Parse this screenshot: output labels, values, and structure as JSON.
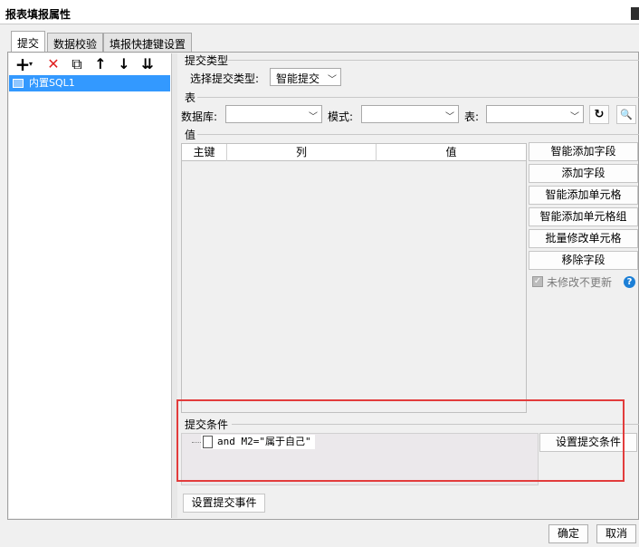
{
  "window": {
    "title": "报表填报属性"
  },
  "tabs": [
    {
      "label": "提交",
      "active": true
    },
    {
      "label": "数据校验",
      "active": false
    },
    {
      "label": "填报快捷键设置",
      "active": false
    }
  ],
  "left_toolbar": {
    "icons": [
      "add-icon",
      "delete-icon",
      "copy-icon",
      "move-up-icon",
      "move-down-icon",
      "move-bottom-icon"
    ],
    "glyphs": {
      "add": "+",
      "add_caret": "▾",
      "delete": "✕",
      "copy": "⧉",
      "up": "↑",
      "down": "↓",
      "bottom": "⇊"
    }
  },
  "tree": {
    "items": [
      {
        "label": "内置SQL1",
        "selected": true
      }
    ]
  },
  "submit_type": {
    "section_label": "提交类型",
    "field_label": "选择提交类型:",
    "value": "智能提交"
  },
  "table_section": {
    "section_label": "表",
    "database_label": "数据库:",
    "database_value": "",
    "schema_label": "模式:",
    "schema_value": "",
    "table_label": "表:",
    "table_value": "",
    "refresh_glyph": "↻",
    "search_glyph": "🔍"
  },
  "value_section": {
    "section_label": "值",
    "columns": [
      "主键",
      "列",
      "值"
    ],
    "rows": []
  },
  "side_buttons": [
    "智能添加字段",
    "添加字段",
    "智能添加单元格",
    "智能添加单元格组",
    "批量修改单元格",
    "移除字段"
  ],
  "no_update_checkbox": {
    "label": "未修改不更新",
    "checked": true,
    "glyph": "✓",
    "help_glyph": "?"
  },
  "submit_condition": {
    "section_label": "提交条件",
    "items": [
      "and M2=\"属于自己\""
    ],
    "button": "设置提交条件"
  },
  "submit_event_button": "设置提交事件",
  "footer": {
    "ok": "确定",
    "cancel": "取消"
  },
  "colors": {
    "highlight": "#e23c3c",
    "selection": "#3399ff",
    "help": "#1c7fd6"
  }
}
